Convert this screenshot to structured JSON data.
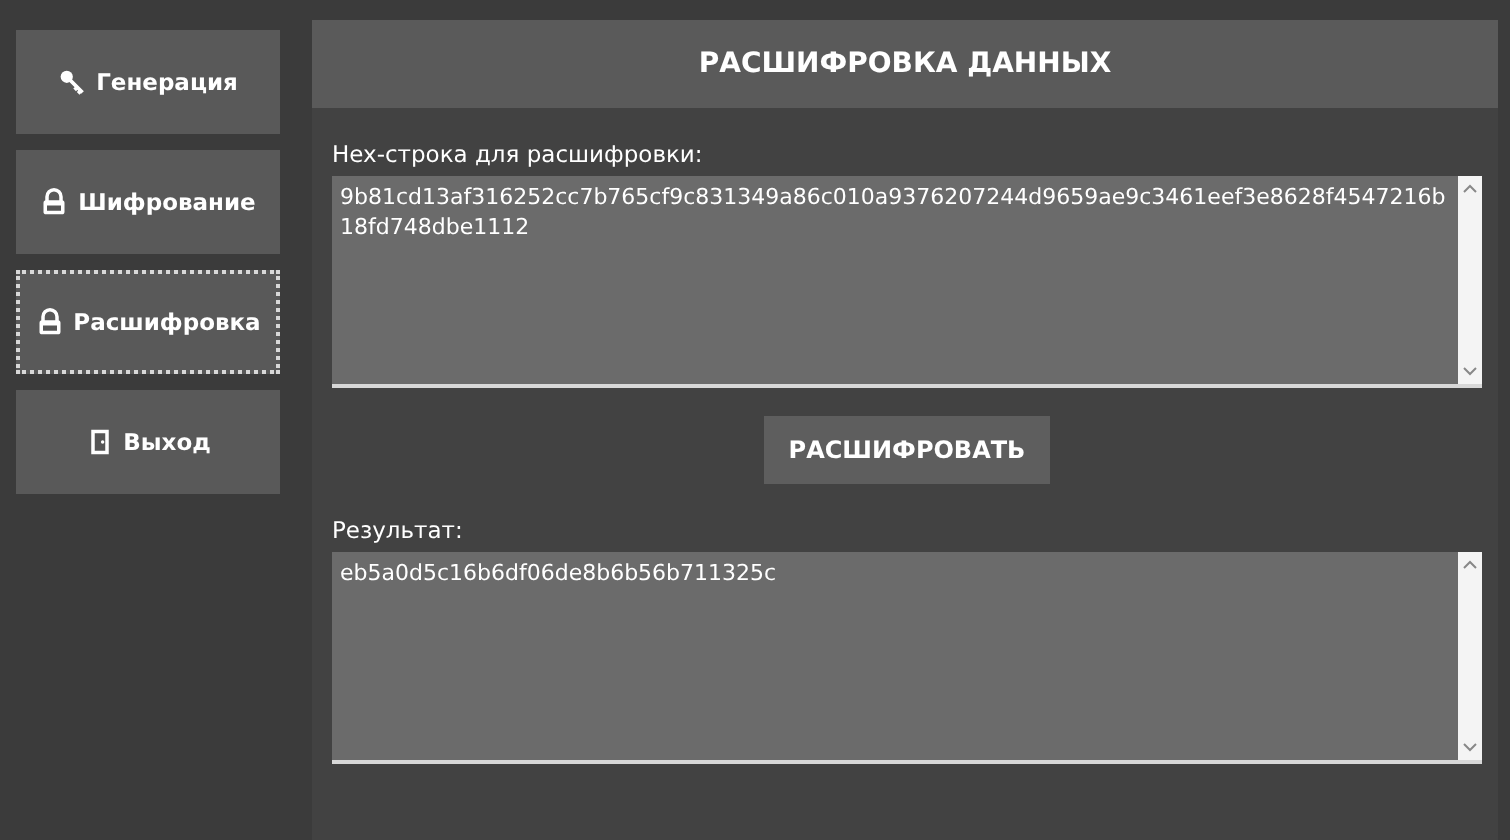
{
  "sidebar": {
    "items": [
      {
        "label": "Генерация",
        "kind": "generate",
        "selected": false
      },
      {
        "label": "Шифрование",
        "kind": "encrypt",
        "selected": false
      },
      {
        "label": "Расшифровка",
        "kind": "decrypt",
        "selected": true
      },
      {
        "label": "Выход",
        "kind": "exit",
        "selected": false
      }
    ]
  },
  "header": {
    "title": "РАСШИФРОВКА ДАННЫХ"
  },
  "input": {
    "label": "Hex-строка для расшифровки:",
    "value": "9b81cd13af316252cc7b765cf9c831349a86c010a9376207244d9659ae9c3461eef3e8628f4547216b18fd748dbe1112"
  },
  "action_button": {
    "label": "РАСШИФРОВАТЬ"
  },
  "output": {
    "label": "Результат:",
    "value": "eb5a0d5c16b6df06de8b6b56b711325c"
  }
}
